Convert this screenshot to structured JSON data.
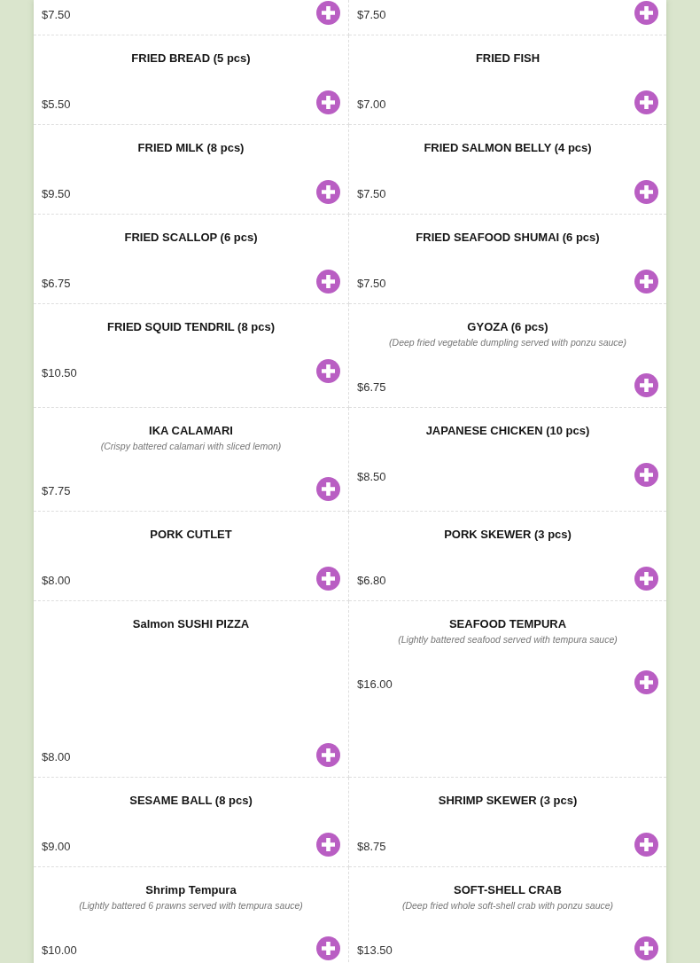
{
  "menu_items": [
    {
      "kind": "dish",
      "price": "$7.50"
    },
    {
      "kind": "dish",
      "price": "$7.50"
    },
    {
      "kind": "dish",
      "name": "FRIED BREAD (5 pcs)",
      "price": "$5.50"
    },
    {
      "kind": "dish",
      "name": "FRIED FISH",
      "price": "$7.00"
    },
    {
      "kind": "dish",
      "name": "FRIED MILK (8 pcs)",
      "price": "$9.50"
    },
    {
      "kind": "dish",
      "name": "FRIED SALMON BELLY (4 pcs)",
      "price": "$7.50"
    },
    {
      "kind": "dish",
      "name": "FRIED SCALLOP (6 pcs)",
      "price": "$6.75"
    },
    {
      "kind": "dish",
      "name": "FRIED SEAFOOD SHUMAI (6 pcs)",
      "price": "$7.50"
    },
    {
      "kind": "dish",
      "name": "FRIED SQUID TENDRIL (8 pcs)",
      "price": "$10.50"
    },
    {
      "kind": "dish",
      "name": "GYOZA (6 pcs)",
      "description": "(Deep fried vegetable dumpling served with ponzu sauce)",
      "price": "$6.75"
    },
    {
      "kind": "dish",
      "name": "IKA CALAMARI",
      "description": "(Crispy battered calamari with sliced lemon)",
      "price": "$7.75"
    },
    {
      "kind": "dish",
      "name": "JAPANESE CHICKEN (10 pcs)",
      "price": "$8.50"
    },
    {
      "kind": "dish",
      "name": "PORK CUTLET",
      "price": "$8.00"
    },
    {
      "kind": "dish",
      "name": "PORK SKEWER (3 pcs)",
      "price": "$6.80"
    },
    {
      "kind": "spaced",
      "name": "Salmon SUSHI PIZZA",
      "price": "$8.00"
    },
    {
      "kind": "dish",
      "name": "SEAFOOD TEMPURA",
      "description": "(Lightly battered seafood served with tempura sauce)",
      "price": "$16.00"
    },
    {
      "kind": "dish",
      "name": "SESAME BALL (8 pcs)",
      "price": "$9.00"
    },
    {
      "kind": "dish",
      "name": "SHRIMP SKEWER (3 pcs)",
      "price": "$8.75"
    },
    {
      "kind": "dish",
      "name": "Shrimp Tempura",
      "description": "(Lightly battered 6 prawns served with tempura sauce)",
      "price": "$10.00"
    },
    {
      "kind": "dish",
      "name": "SOFT-SHELL CRAB",
      "description": "(Deep fried whole soft-shell crab with ponzu sauce)",
      "price": "$13.50"
    }
  ]
}
